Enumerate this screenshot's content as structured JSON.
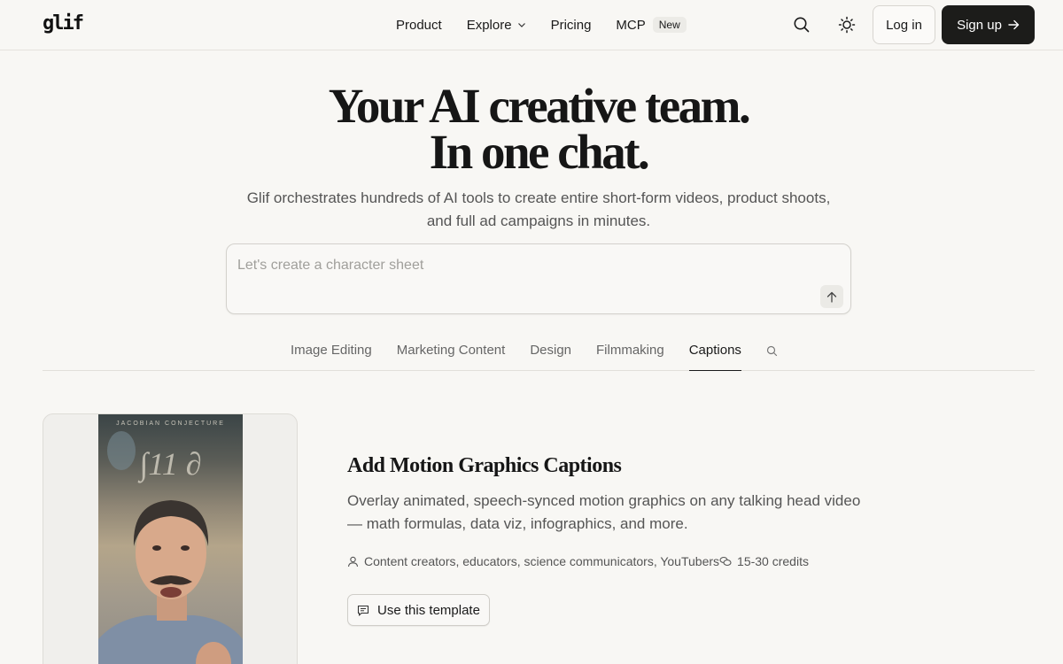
{
  "header": {
    "logo": "glif",
    "nav": [
      {
        "label": "Product"
      },
      {
        "label": "Explore"
      },
      {
        "label": "Pricing"
      },
      {
        "label": "MCP",
        "badge": "New"
      }
    ],
    "login_label": "Log in",
    "signup_label": "Sign up"
  },
  "hero": {
    "title_line1": "Your AI creative team.",
    "title_line2": "In one chat.",
    "subtitle": "Glif orchestrates hundreds of AI tools to create entire short-form videos, product shoots, and full ad campaigns in minutes.",
    "prompt_placeholder": "Let's create a character sheet"
  },
  "tabs": {
    "items": [
      "Image Editing",
      "Marketing Content",
      "Design",
      "Filmmaking",
      "Captions"
    ],
    "active": "Captions"
  },
  "template": {
    "title": "Add Motion Graphics Captions",
    "description": "Overlay animated, speech-synced motion graphics on any talking head video — math formulas, data viz, infographics, and more.",
    "audience": "Content creators, educators, science communicators, YouTubers",
    "credits": "15-30 credits",
    "button_label": "Use this template",
    "video_caption": "JACOBIAN CONJECTURE",
    "video_formula": "∫11 ∂"
  },
  "colors": {
    "background": "#f8f7f4",
    "primary_button": "#1c1c1a",
    "text": "#1a1a1a",
    "muted_text": "#555555"
  }
}
